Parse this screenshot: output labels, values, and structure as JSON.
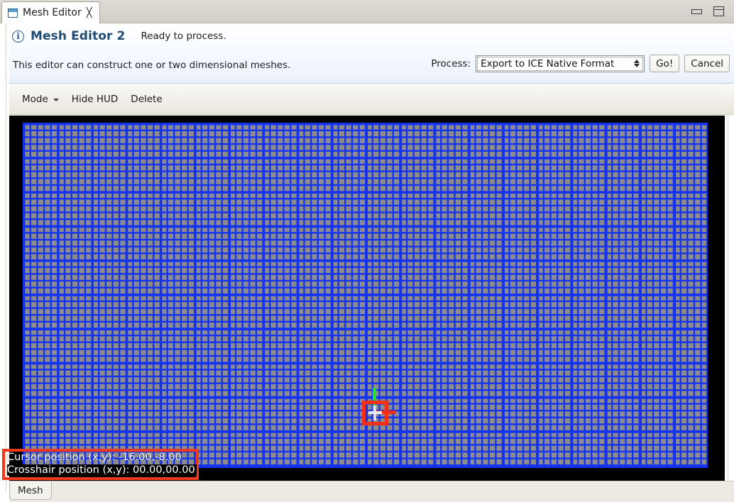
{
  "window": {
    "tab": {
      "title": "Mesh Editor",
      "close_glyph": "╳",
      "icon": "editor-window-icon"
    },
    "controls": {
      "minimize": "minimize-icon",
      "maximize": "maximize-icon"
    }
  },
  "form_header": {
    "icon": "info-icon",
    "icon_glyph": "i",
    "title": "Mesh Editor 2",
    "status": "Ready to process.",
    "description": "This editor can construct one or two dimensional meshes."
  },
  "process": {
    "label": "Process:",
    "selected": "Export to ICE Native Format",
    "options": [
      "Export to ICE Native Format"
    ],
    "go_label": "Go!",
    "cancel_label": "Cancel"
  },
  "toolbar": {
    "mode_label": "Mode",
    "mode_caret": "chevron-down-icon",
    "hide_hud_label": "Hide HUD",
    "delete_label": "Delete"
  },
  "canvas": {
    "background_color": "#000000",
    "grid_cell_color": "#8c8c8c",
    "grid_line_color": "#1432f0",
    "marker": {
      "axis_up_color": "#1ee028",
      "axis_right_color": "#f03018",
      "selection_box_color": "#f03018",
      "cursor_cross_color": "#e8e8f2"
    }
  },
  "hud": {
    "selection_border_color": "#f0391a",
    "text_color": "#ffffff",
    "cursor_position_line": "Cursor position (x,y): -16.00,-8.00",
    "crosshair_position_line": "Crosshair position (x,y): 00.00,00.00"
  },
  "bottom": {
    "tab_label": "Mesh"
  }
}
